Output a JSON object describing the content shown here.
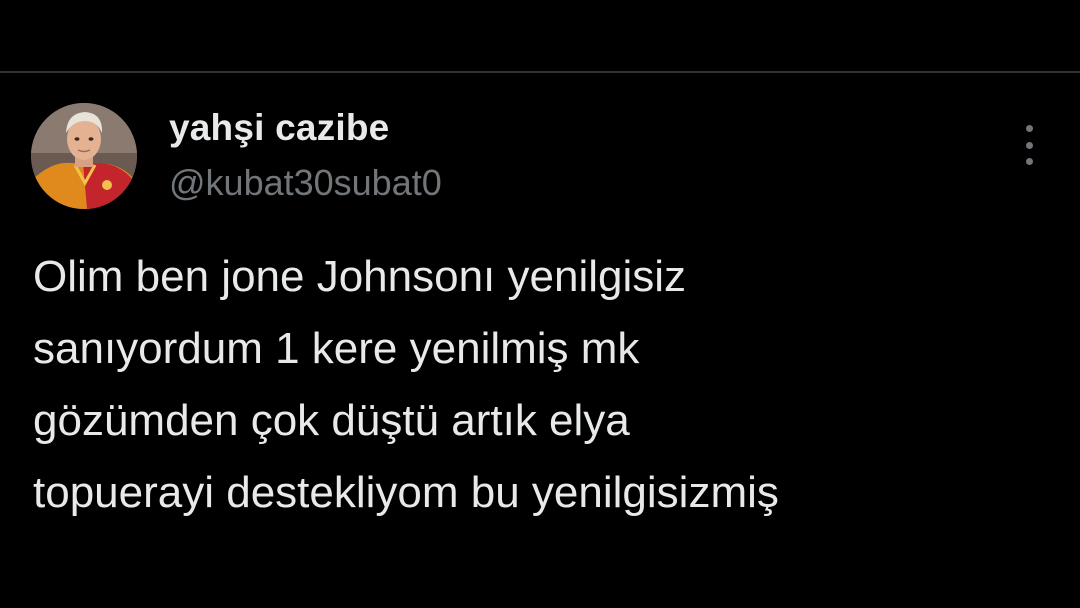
{
  "tweet": {
    "display_name": "yahşi cazibe",
    "handle": "@kubat30subat0",
    "text_lines": [
      "Olim ben jone Johnsonı yenilgisiz",
      "sanıyordum 1 kere yenilmiş mk",
      "gözümden çok düştü artık elya",
      "topuerayi destekliyom bu yenilgisizmiş"
    ]
  },
  "icons": {
    "avatar": "profile-photo",
    "more": "more-options-icon"
  },
  "colors": {
    "background": "#000000",
    "primary_text": "#e7e9ea",
    "secondary_text": "#71767b",
    "divider": "#2f3336"
  }
}
